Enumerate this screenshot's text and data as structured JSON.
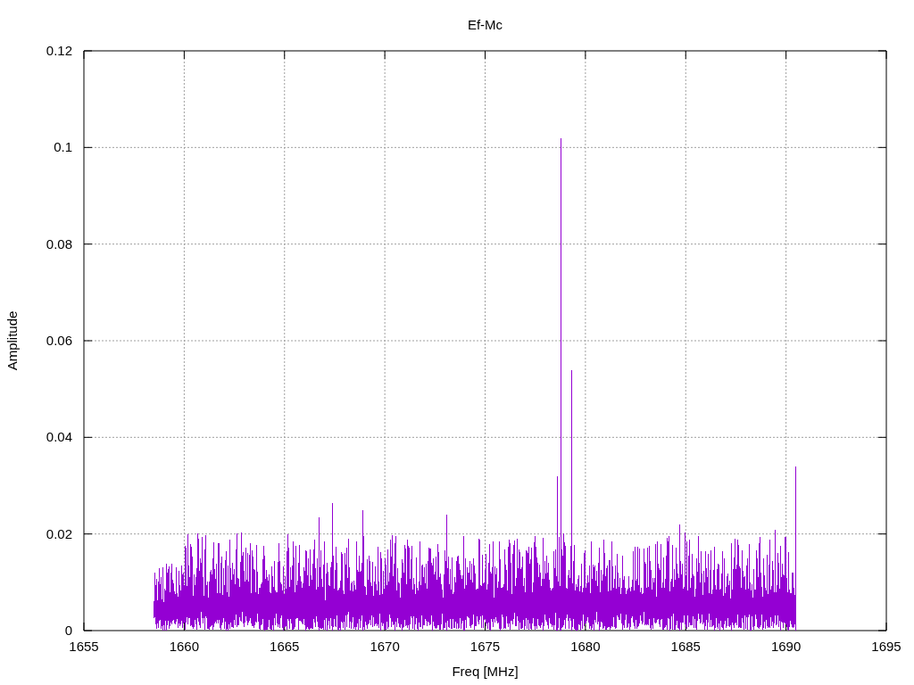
{
  "chart": {
    "chart_data": {
      "type": "line",
      "title": "Ef-Mc",
      "xlabel": "Freq [MHz]",
      "ylabel": "Amplitude",
      "xlim": [
        1655,
        1695
      ],
      "ylim": [
        0,
        0.12
      ],
      "grid": true,
      "xticks": [
        1655,
        1660,
        1665,
        1670,
        1675,
        1680,
        1685,
        1690,
        1695
      ],
      "yticks": [
        {
          "value": 0,
          "label": "0"
        },
        {
          "value": 0.02,
          "label": "0.02"
        },
        {
          "value": 0.04,
          "label": "0.04"
        },
        {
          "value": 0.06,
          "label": "0.06"
        },
        {
          "value": 0.08,
          "label": "0.08"
        },
        {
          "value": 0.1,
          "label": "0.1"
        },
        {
          "value": 0.12,
          "label": "0.12"
        }
      ]
    }
  }
}
